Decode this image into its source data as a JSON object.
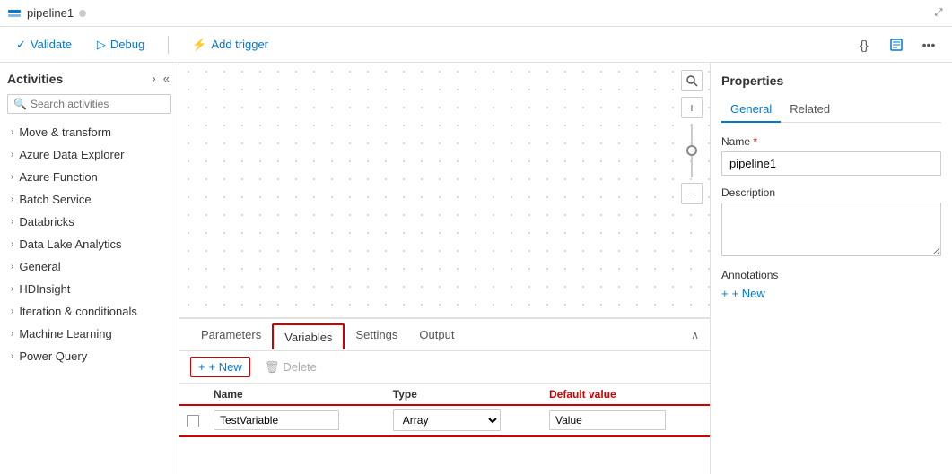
{
  "titleBar": {
    "icon": "pipeline-icon",
    "title": "pipeline1",
    "dot": "unsaved-indicator"
  },
  "toolbar": {
    "validate": "Validate",
    "debug": "Debug",
    "addTrigger": "Add trigger",
    "codeIcon": "{}",
    "noteIcon": "📋",
    "moreIcon": "..."
  },
  "sidebar": {
    "title": "Activities",
    "collapseLabel": "«",
    "arrowLabel": "›",
    "searchPlaceholder": "Search activities",
    "items": [
      {
        "label": "Move & transform"
      },
      {
        "label": "Azure Data Explorer"
      },
      {
        "label": "Azure Function"
      },
      {
        "label": "Batch Service"
      },
      {
        "label": "Databricks"
      },
      {
        "label": "Data Lake Analytics"
      },
      {
        "label": "General"
      },
      {
        "label": "HDInsight"
      },
      {
        "label": "Iteration & conditionals"
      },
      {
        "label": "Machine Learning"
      },
      {
        "label": "Power Query"
      }
    ]
  },
  "canvas": {
    "zoomIn": "+",
    "zoomOut": "−"
  },
  "bottomPanel": {
    "tabs": [
      {
        "label": "Parameters",
        "active": false
      },
      {
        "label": "Variables",
        "active": true,
        "outlined": true
      },
      {
        "label": "Settings",
        "active": false
      },
      {
        "label": "Output",
        "active": false
      }
    ],
    "newBtn": "+ New",
    "deleteBtn": "Delete",
    "columns": [
      {
        "label": "Name"
      },
      {
        "label": "Type"
      },
      {
        "label": "Default value"
      }
    ],
    "rows": [
      {
        "name": "TestVariable",
        "type": "Array",
        "defaultValue": "Value"
      }
    ]
  },
  "propertiesPanel": {
    "title": "Properties",
    "tabs": [
      {
        "label": "General",
        "active": true
      },
      {
        "label": "Related",
        "active": false
      }
    ],
    "nameLabel": "Name",
    "nameRequired": "*",
    "nameValue": "pipeline1",
    "descriptionLabel": "Description",
    "descriptionValue": "",
    "annotationsLabel": "Annotations",
    "newAnnotationBtn": "+ New"
  }
}
